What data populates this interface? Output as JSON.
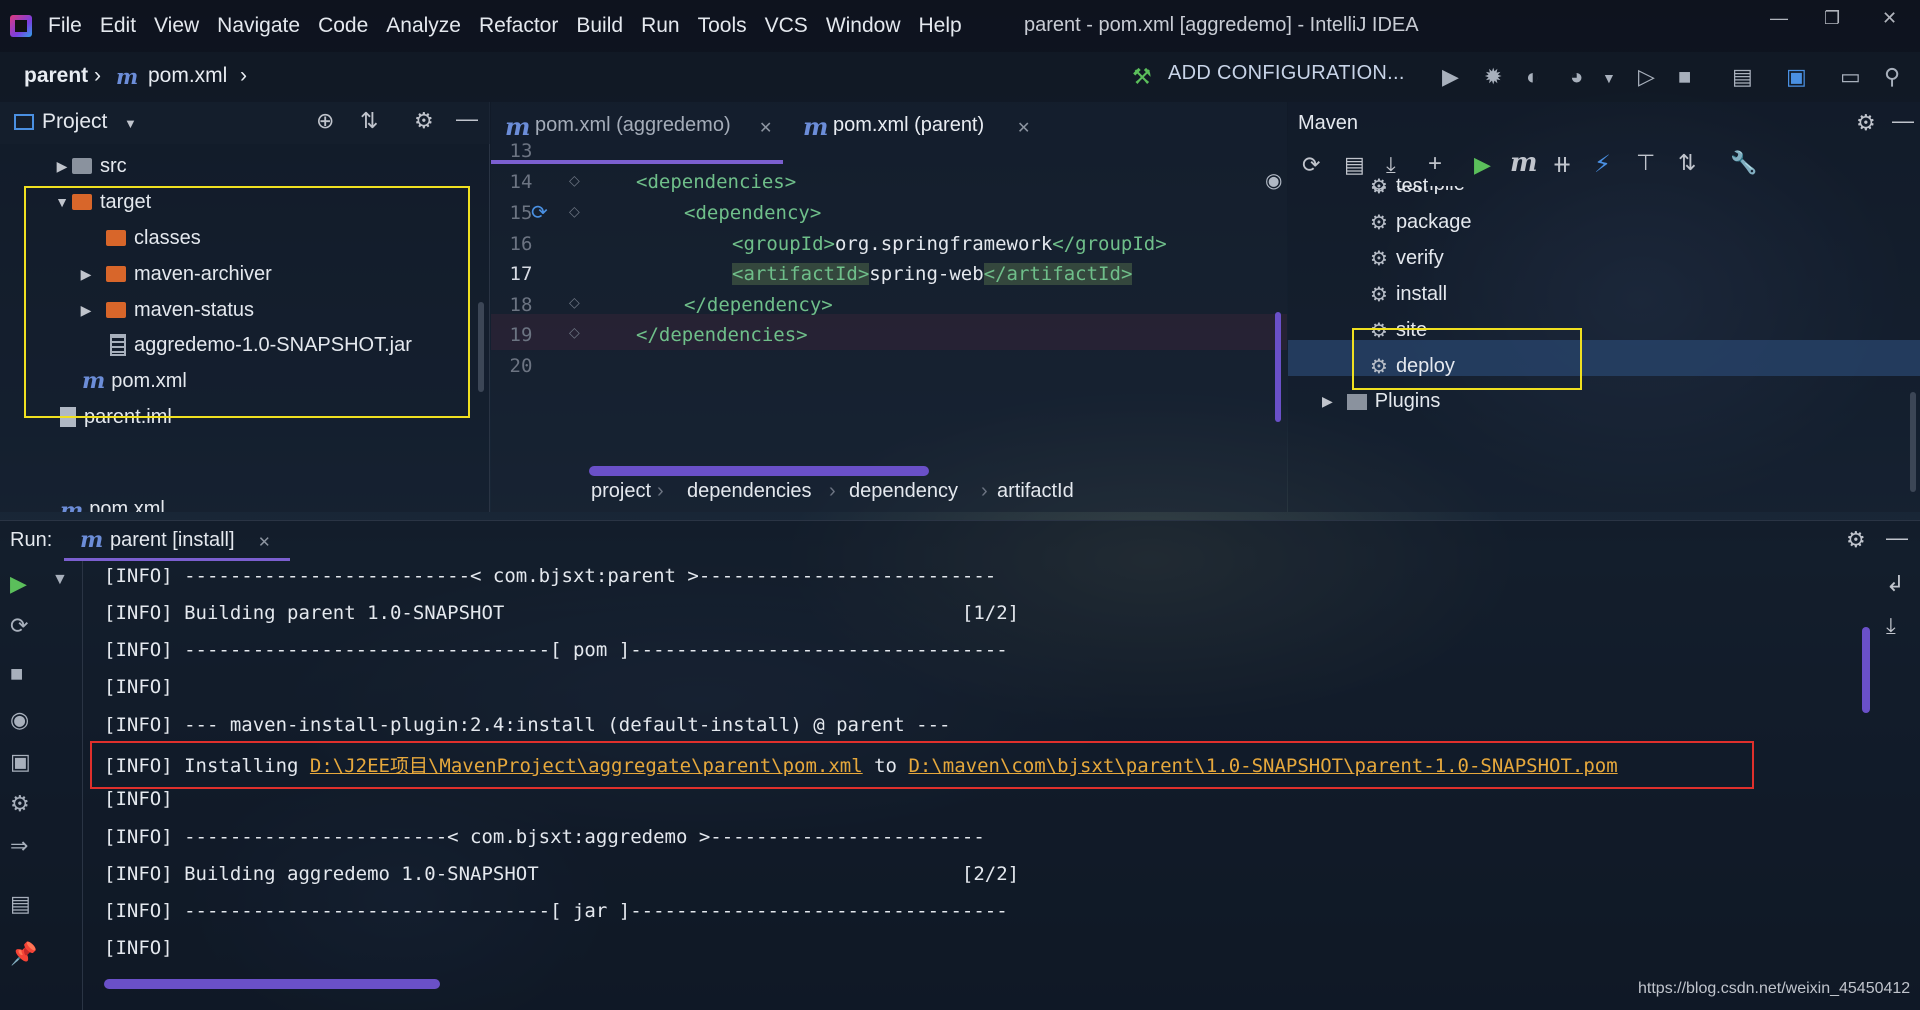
{
  "menubar": {
    "items": [
      "File",
      "Edit",
      "View",
      "Navigate",
      "Code",
      "Analyze",
      "Refactor",
      "Build",
      "Run",
      "Tools",
      "VCS",
      "Window",
      "Help"
    ],
    "window_title": "parent - pom.xml [aggredemo] - IntelliJ IDEA"
  },
  "navbar": {
    "crumb_project": "parent",
    "crumb_file": "pom.xml",
    "add_configuration": "ADD CONFIGURATION..."
  },
  "project": {
    "title": "Project",
    "tree": [
      {
        "label": "src",
        "icon": "folder-grey"
      },
      {
        "label": "target",
        "icon": "folder-orange"
      },
      {
        "label": "classes",
        "icon": "folder-orange"
      },
      {
        "label": "maven-archiver",
        "icon": "folder-orange"
      },
      {
        "label": "maven-status",
        "icon": "folder-orange"
      },
      {
        "label": "aggredemo-1.0-SNAPSHOT.jar",
        "icon": "jar"
      },
      {
        "label": "pom.xml",
        "icon": "maven"
      },
      {
        "label": "parent.iml",
        "icon": "file"
      },
      {
        "label": "pom.xml",
        "icon": "maven"
      }
    ]
  },
  "editor": {
    "tabs": [
      {
        "label": "pom.xml (aggredemo)"
      },
      {
        "label": "pom.xml (parent)"
      }
    ],
    "line_numbers": [
      "13",
      "14",
      "15",
      "16",
      "17",
      "18",
      "19",
      "20"
    ],
    "code": {
      "l14_open": "<dependencies>",
      "l15_open": "<dependency>",
      "l16_open": "<groupId>",
      "l16_text": "org.springframework",
      "l16_close": "</groupId>",
      "l17_open": "<artifactId>",
      "l17_text": "spring-web",
      "l17_close": "</artifactId>",
      "l18_close": "</dependency>",
      "l19_close": "</dependencies>"
    },
    "breadcrumb": [
      "project",
      "dependencies",
      "dependency",
      "artifactId"
    ]
  },
  "maven": {
    "title": "Maven",
    "lifecycle": [
      "compile",
      "test",
      "package",
      "verify",
      "install",
      "site",
      "deploy"
    ],
    "plugins_label": "Plugins"
  },
  "run": {
    "label": "Run:",
    "tab_label": "parent [install]",
    "lines": {
      "l1": "[INFO] -------------------------< com.bjsxt:parent >--------------------------",
      "l2": "[INFO] Building parent 1.0-SNAPSHOT                                        [1/2]",
      "l3": "[INFO] --------------------------------[ pom ]---------------------------------",
      "l4": "[INFO]",
      "l5": "[INFO] --- maven-install-plugin:2.4:install (default-install) @ parent ---",
      "l6_prefix": "[INFO] Installing ",
      "l6_src": "D:\\J2EE项目\\MavenProject\\aggregate\\parent\\pom.xml",
      "l6_mid": " to ",
      "l6_dst": "D:\\maven\\com\\bjsxt\\parent\\1.0-SNAPSHOT\\parent-1.0-SNAPSHOT.pom",
      "l7": "[INFO]",
      "l8": "[INFO] -----------------------< com.bjsxt:aggredemo >------------------------",
      "l9": "[INFO] Building aggredemo 1.0-SNAPSHOT                                     [2/2]",
      "l10": "[INFO] --------------------------------[ jar ]---------------------------------",
      "l11": "[INFO]"
    }
  },
  "watermark": "https://blog.csdn.net/weixin_45450412",
  "colors": {
    "highlight_yellow": "#f0e020",
    "highlight_red": "#e0302c",
    "xml_tag": "#6fbf8a",
    "link": "#e6a83c",
    "accent_tab": "#7b5fd0"
  }
}
